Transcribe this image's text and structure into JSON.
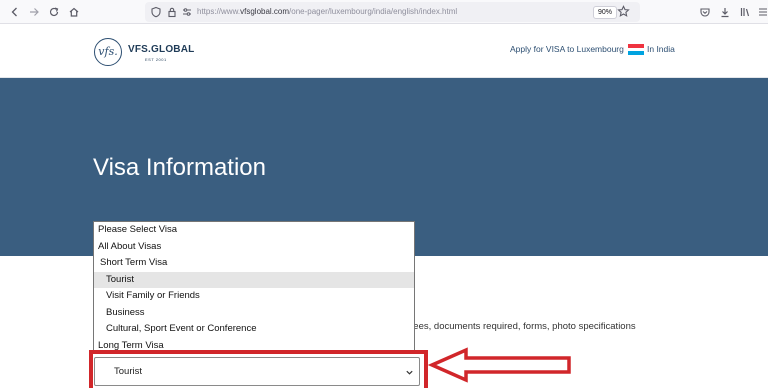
{
  "browser": {
    "url_prefix": "https://www.",
    "url_host": "vfsglobal.com",
    "url_path": "/one-pager/luxembourg/india/english/index.html",
    "zoom": "90%"
  },
  "header": {
    "logo_mark": "vfs.",
    "logo_text": "VFS.GLOBAL",
    "logo_sub": "EST 2001",
    "apply_text": "Apply for VISA to Luxembourg",
    "apply_suffix": "In India",
    "flag_colors": [
      "#ef3340",
      "#ffffff",
      "#00a3e0"
    ]
  },
  "banner": {
    "title": "Visa Information"
  },
  "dropdown": {
    "items": [
      {
        "label": "Please Select Visa"
      },
      {
        "label": "All About Visas"
      },
      {
        "label": "Short Term Visa"
      },
      {
        "label": "Tourist"
      },
      {
        "label": "Visit Family or Friends"
      },
      {
        "label": "Business"
      },
      {
        "label": "Cultural, Sport Event or Conference"
      },
      {
        "label": "Long Term Visa"
      }
    ],
    "selected_value": "Tourist"
  },
  "content": {
    "partial_line": "sa fees, documents required, forms, photo specifications"
  },
  "annotation": {
    "color": "#d1262a"
  }
}
